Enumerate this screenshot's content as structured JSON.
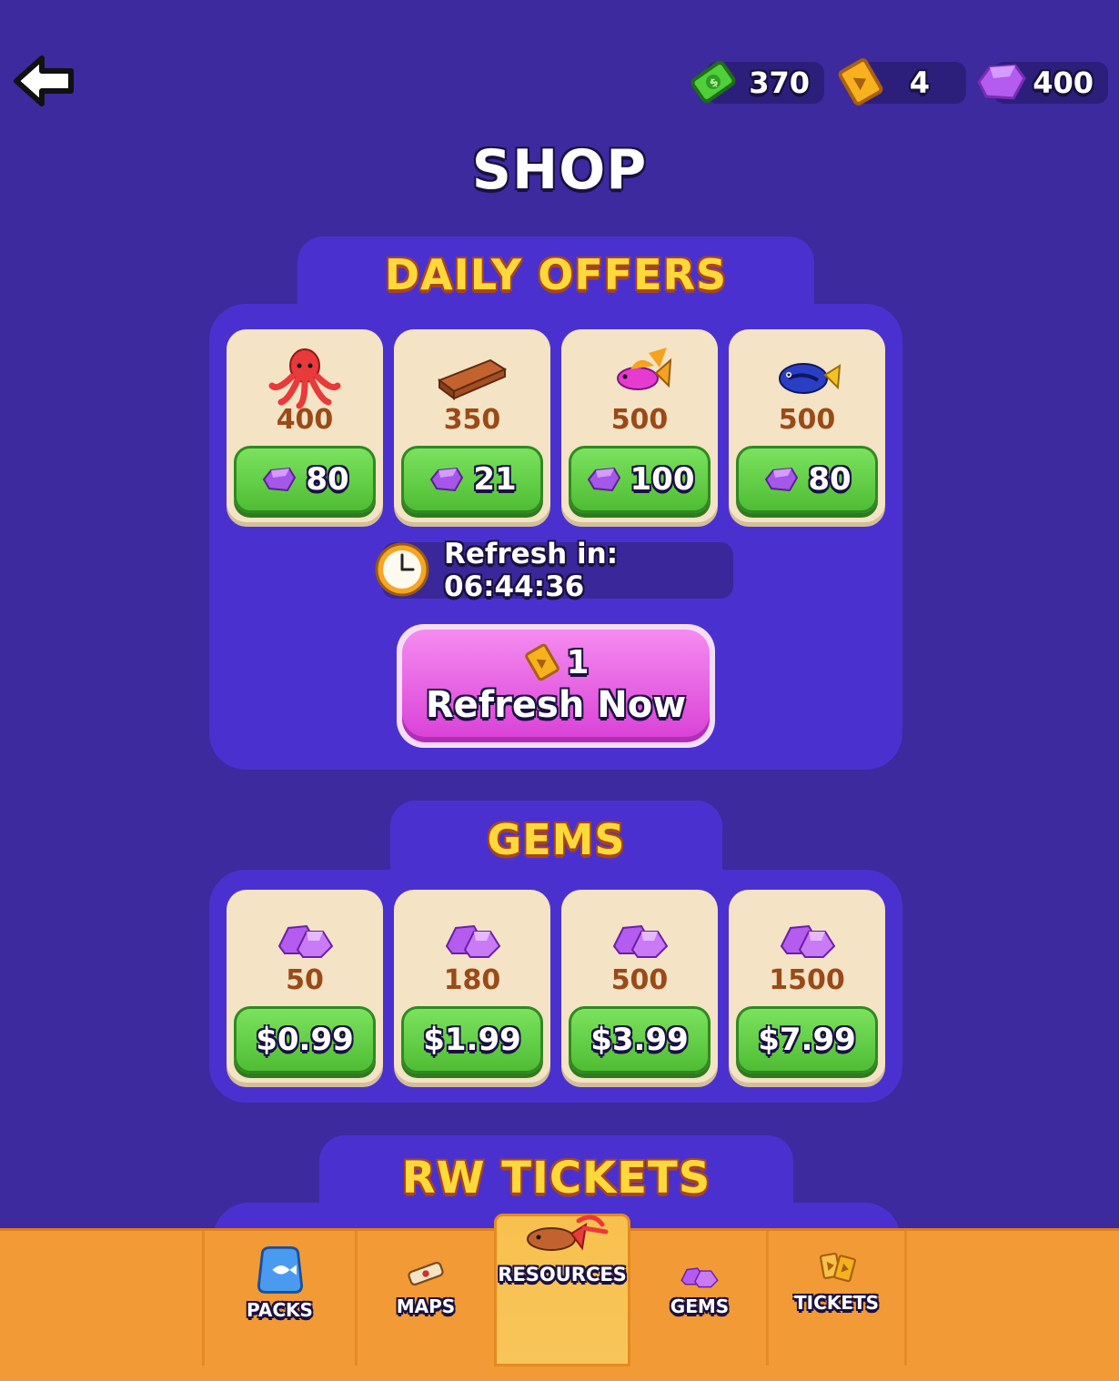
{
  "header": {
    "currencies": [
      {
        "name": "cash",
        "amount": "370",
        "icon": "cash-icon",
        "color": "#4fcf3a"
      },
      {
        "name": "tickets",
        "amount": "4",
        "icon": "ticket-icon",
        "color": "#f7b11f"
      },
      {
        "name": "gems",
        "amount": "400",
        "icon": "gem-icon",
        "color": "#b45bf0"
      }
    ]
  },
  "title": "SHOP",
  "daily_offers": {
    "title": "DAILY OFFERS",
    "items": [
      {
        "icon": "octopus-icon",
        "quantity": "400",
        "price": "80"
      },
      {
        "icon": "wood-plank-icon",
        "quantity": "350",
        "price": "21"
      },
      {
        "icon": "pink-fish-icon",
        "quantity": "500",
        "price": "100"
      },
      {
        "icon": "blue-tang-fish-icon",
        "quantity": "500",
        "price": "80"
      }
    ],
    "refresh_timer": "Refresh in: 06:44:36",
    "refresh_button": {
      "cost": "1",
      "label": "Refresh Now"
    }
  },
  "gems": {
    "title": "GEMS",
    "items": [
      {
        "icon": "gem-pile-icon",
        "quantity": "50",
        "price": "$0.99"
      },
      {
        "icon": "gem-pile-icon",
        "quantity": "180",
        "price": "$1.99"
      },
      {
        "icon": "gem-pile-icon",
        "quantity": "500",
        "price": "$3.99"
      },
      {
        "icon": "gem-pile-icon",
        "quantity": "1500",
        "price": "$7.99"
      }
    ]
  },
  "rw_tickets": {
    "title": "RW TICKETS"
  },
  "bottom_nav": {
    "active": "RESOURCES",
    "items": [
      {
        "label": "PACKS",
        "icon": "fish-bag-icon"
      },
      {
        "label": "MAPS",
        "icon": "scroll-map-icon"
      },
      {
        "label": "RESOURCES",
        "icon": "resources-icon"
      },
      {
        "label": "GEMS",
        "icon": "gems-icon"
      },
      {
        "label": "TICKETS",
        "icon": "tickets-icon"
      }
    ]
  },
  "colors": {
    "background": "#3c2a9e",
    "panel": "#4a31cf",
    "card": "#f4e3c4",
    "buy_button": "#5cc93e",
    "refresh_button": "#e45ee0",
    "nav_bar": "#f29a36",
    "title_yellow": "#ffd93a"
  }
}
